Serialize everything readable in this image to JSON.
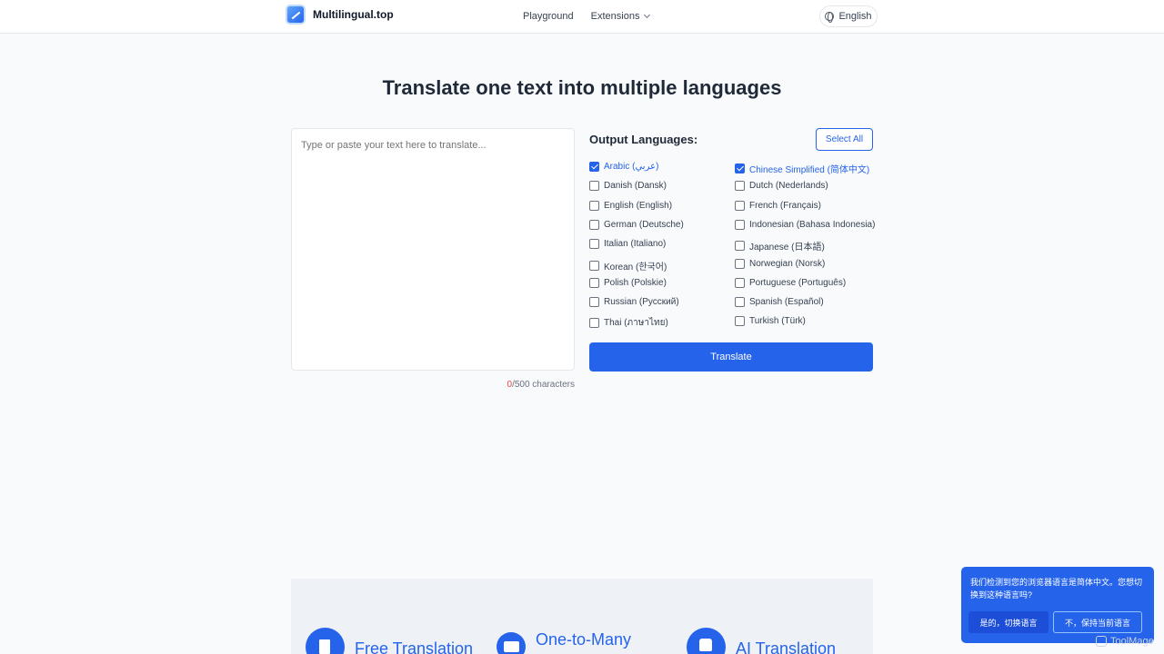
{
  "header": {
    "logo_text": "Multilingual.top",
    "nav": {
      "playground": "Playground",
      "extensions": "Extensions"
    },
    "language": "English"
  },
  "hero": {
    "title": "Translate one text into multiple languages"
  },
  "input": {
    "placeholder": "Type or paste your text here to translate...",
    "count": "0",
    "count_suffix": "/500 characters"
  },
  "languages": {
    "title": "Output Languages:",
    "select_all": "Select All",
    "items": [
      {
        "label": "Arabic (عربي)",
        "checked": true
      },
      {
        "label": "Chinese Simplified (简体中文)",
        "checked": true
      },
      {
        "label": "Danish (Dansk)",
        "checked": false
      },
      {
        "label": "Dutch (Nederlands)",
        "checked": false
      },
      {
        "label": "English (English)",
        "checked": false
      },
      {
        "label": "French (Français)",
        "checked": false
      },
      {
        "label": "German (Deutsche)",
        "checked": false
      },
      {
        "label": "Indonesian (Bahasa Indonesia)",
        "checked": false
      },
      {
        "label": "Italian (Italiano)",
        "checked": false
      },
      {
        "label": "Japanese (日本語)",
        "checked": false
      },
      {
        "label": "Korean (한국어)",
        "checked": false
      },
      {
        "label": "Norwegian (Norsk)",
        "checked": false
      },
      {
        "label": "Polish (Polskie)",
        "checked": false
      },
      {
        "label": "Portuguese (Português)",
        "checked": false
      },
      {
        "label": "Russian (Русский)",
        "checked": false
      },
      {
        "label": "Spanish (Español)",
        "checked": false
      },
      {
        "label": "Thai (ภาษาไทย)",
        "checked": false
      },
      {
        "label": "Turkish (Türk)",
        "checked": false
      }
    ],
    "translate": "Translate"
  },
  "features": [
    {
      "title": "Free Translation",
      "icon": "document-icon"
    },
    {
      "title": "One-to-Many",
      "icon": "folder-icon"
    },
    {
      "title": "AI Translation",
      "icon": "thumbs-up-icon"
    }
  ],
  "toast": {
    "message": "我们检测到您的浏览器语言是简体中文。您想切换到这种语言吗?",
    "yes": "是的，切换语言",
    "no": "不，保持当前语言"
  },
  "watermark": "ToolMage",
  "colors": {
    "accent": "#2563eb",
    "background": "#f8fafc"
  }
}
